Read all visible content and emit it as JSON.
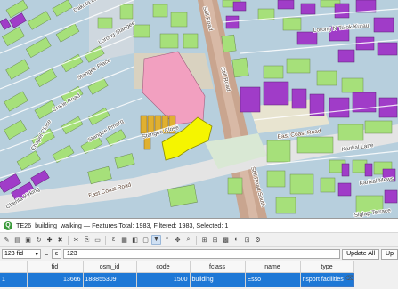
{
  "map": {
    "labels": {
      "dakota_lane": "Dakota Lane",
      "lorong_n_telok_kurau": "Lorong N Telok Kurau",
      "lorong_stangee": "Lorong Stangee",
      "stangee_place": "Stangee Place",
      "stangee_pmarq": "Stangee Pmarq",
      "crane_road": "Crane Road",
      "chapel_close": "Chapel Close",
      "marshall_road": "Marshall Road",
      "east_coast_road_left": "East Coast Road",
      "east_coast_road_right": "East Coast Road",
      "still_road_top": "Still Road",
      "still_road_mid": "Still Road",
      "still_road_bottom": "Still Road South",
      "karikal_lane": "Karikal Lane",
      "karikal_mews": "Karikal Mews",
      "siglap_terrace": "Siglap Terrace",
      "cherita_kirking": "Cherita Kirking",
      "stangee_close": "Stangee Close"
    }
  },
  "attribute_table": {
    "title": "TE26_building_walking — Features Total: 1983, Filtered: 1983, Selected: 1",
    "field_selector": "123 fid",
    "expression_prefix": "=",
    "expression_icon": "ε",
    "expression_value": "123",
    "update_all_label": "Update All",
    "update_selected_label": "Up",
    "columns": [
      "fid",
      "osm_id",
      "code",
      "fclass",
      "name",
      "type"
    ],
    "rows": [
      {
        "row": "1",
        "fid": "13666",
        "osm_id": "188855309",
        "code": "1500",
        "fclass": "building",
        "name": "Esso",
        "type": "nsport facilities"
      }
    ]
  },
  "colors": {
    "building_green": "#a6e07a",
    "building_purple": "#a03cc8",
    "building_selected": "#f5f500",
    "building_orange": "#e0b030",
    "building_pink": "#f2a0c0",
    "selection_blue": "#1e78d6"
  }
}
